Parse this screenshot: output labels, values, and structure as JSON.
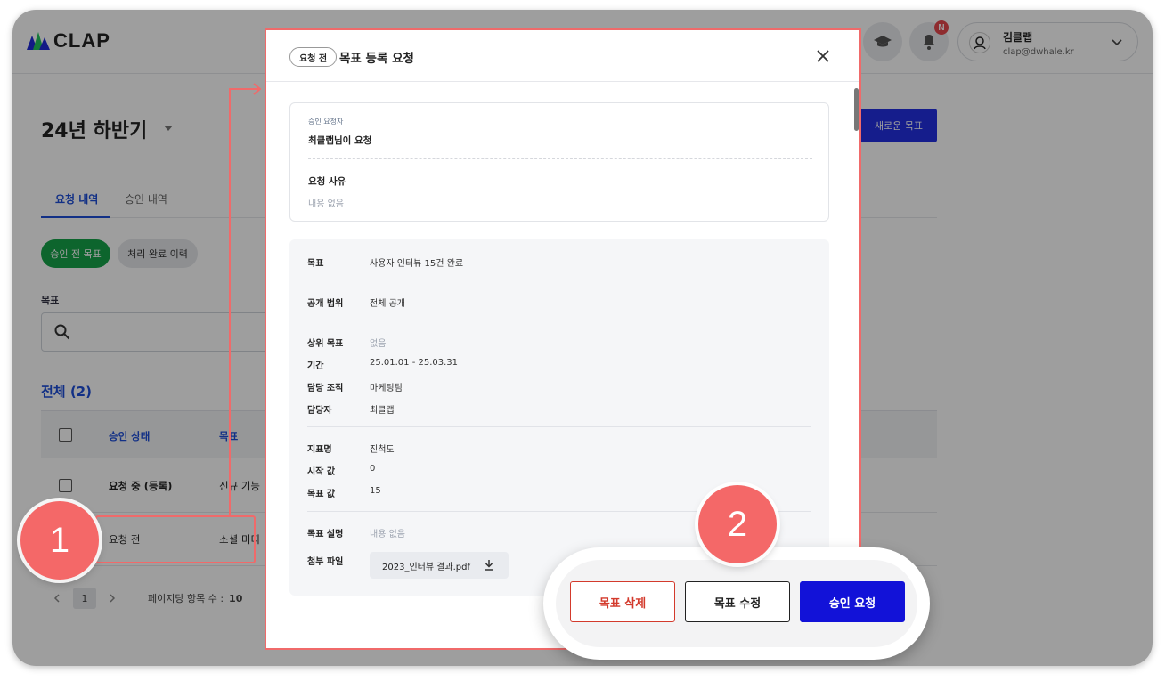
{
  "app": {
    "brand": "CLAP"
  },
  "header": {
    "notification_badge": "N",
    "user": {
      "name": "김클랩",
      "email": "clap@dwhale.kr"
    }
  },
  "page": {
    "period_title": "24년 하반기",
    "new_goal_button": "새로운 목표",
    "tabs": [
      {
        "label": "요청 내역",
        "active": true
      },
      {
        "label": "승인 내역",
        "active": false
      }
    ],
    "filters": [
      {
        "label": "승인 전 목표",
        "active": true
      },
      {
        "label": "처리 완료 이력",
        "active": false
      }
    ],
    "search_label": "목표",
    "total_label": "전체 (2)",
    "table": {
      "headers": [
        "승인 상태",
        "목표"
      ],
      "rows": [
        {
          "status": "요청 중 (등록)",
          "goal": "신규 기능"
        },
        {
          "status": "요청 전",
          "goal": "소셜 미디"
        }
      ]
    },
    "pager": {
      "current_page": "1",
      "per_page_label": "페이지당 항목 수 :",
      "per_page_value": "10"
    }
  },
  "modal": {
    "status_pill": "요청 전",
    "title": "목표 등록 요청",
    "requester_label": "승인 요청자",
    "requester_value": "최클랩님이 요청",
    "reason_label": "요청 사유",
    "reason_value": "내용 없음",
    "details": {
      "goal_label": "목표",
      "goal_value": "사용자 인터뷰 15건 완료",
      "scope_label": "공개 범위",
      "scope_value": "전체 공개",
      "parent_label": "상위 목표",
      "parent_value": "없음",
      "period_label": "기간",
      "period_value": "25.01.01 - 25.03.31",
      "org_label": "담당 조직",
      "org_value": "마케팅팀",
      "owner_label": "담당자",
      "owner_value": "최클랩",
      "metric_label": "지표명",
      "metric_value": "진척도",
      "start_label": "시작 값",
      "start_value": "0",
      "target_label": "목표 값",
      "target_value": "15",
      "desc_label": "목표 설명",
      "desc_value": "내용 없음",
      "file_label": "첨부 파일",
      "file_value": "2023_인터뷰 결과.pdf"
    },
    "actions": {
      "delete": "목표 삭제",
      "edit": "목표 수정",
      "request": "승인 요청"
    }
  },
  "annotations": {
    "callout_1": "1",
    "callout_2": "2"
  },
  "colors": {
    "primary": "#1212d8",
    "accent_red": "#f06a6a",
    "success": "#16a34a",
    "danger": "#d33a2c"
  }
}
